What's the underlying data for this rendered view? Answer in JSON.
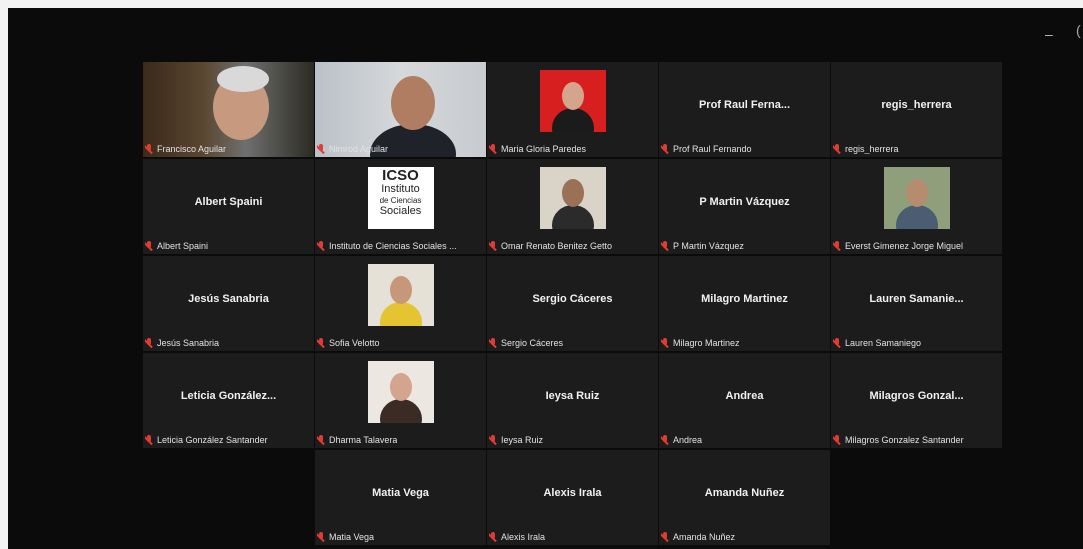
{
  "window": {
    "minimize_glyph": "–",
    "edge_glyph": "("
  },
  "participants": [
    {
      "display": "",
      "label": "Francisco Aguilar",
      "kind": "video",
      "active": true
    },
    {
      "display": "",
      "label": "Nimrod Aguilar",
      "kind": "video"
    },
    {
      "display": "",
      "label": "Maria Gloria Paredes",
      "kind": "photo"
    },
    {
      "display": "Prof Raul Ferna...",
      "label": "Prof Raul Fernando"
    },
    {
      "display": "regis_herrera",
      "label": "regis_herrera"
    },
    {
      "display": "Albert Spaini",
      "label": "Albert Spaini"
    },
    {
      "display": "",
      "label": "Instituto de Ciencias Sociales ...",
      "kind": "logo",
      "logo_text": [
        "ICSO",
        "Instituto",
        "de Ciencias",
        "Sociales"
      ]
    },
    {
      "display": "",
      "label": "Omar Renato Benitez Getto",
      "kind": "photo"
    },
    {
      "display": "P Martin Vázquez",
      "label": "P Martin Vázquez"
    },
    {
      "display": "",
      "label": "Everst Gimenez Jorge Miguel",
      "kind": "photo"
    },
    {
      "display": "Jesús Sanabria",
      "label": "Jesús Sanabria"
    },
    {
      "display": "",
      "label": "Sofia Velotto",
      "kind": "photo"
    },
    {
      "display": "Sergio Cáceres",
      "label": "Sergio Cáceres"
    },
    {
      "display": "Milagro Martinez",
      "label": "Milagro Martinez"
    },
    {
      "display": "Lauren Samanie...",
      "label": "Lauren Samaniego"
    },
    {
      "display": "Leticia González...",
      "label": "Leticia González Santander"
    },
    {
      "display": "",
      "label": "Dharma Talavera",
      "kind": "photo"
    },
    {
      "display": "Ieysa Ruiz",
      "label": "Ieysa Ruiz"
    },
    {
      "display": "Andrea",
      "label": "Andrea"
    },
    {
      "display": "Milagros Gonzal...",
      "label": "Milagros Gonzalez Santander"
    },
    {
      "display": "Matia Vega",
      "label": "Matia Vega"
    },
    {
      "display": "Alexis Irala",
      "label": "Alexis Irala"
    },
    {
      "display": "Amanda Nuñez",
      "label": "Amanda Nuñez"
    }
  ],
  "colors": {
    "tile_bg": "#1c1c1c",
    "active_border": "#3ec464",
    "mic_muted": "#e23b32"
  }
}
